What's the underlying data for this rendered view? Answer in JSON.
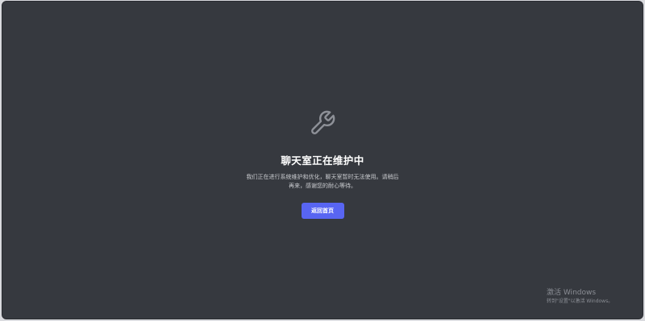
{
  "maintenance": {
    "icon": "wrench-icon",
    "title": "聊天室正在维护中",
    "description": "我们正在进行系统维护和优化，聊天室暂时无法使用。请稍后再来，感谢您的耐心等待。",
    "button_label": "返回首页"
  },
  "activation": {
    "title": "激活 Windows",
    "subtitle": "转到\"设置\"以激活 Windows。"
  },
  "colors": {
    "background": "#36393f",
    "accent": "#5865f2",
    "title": "#ffffff",
    "text": "#c9cbcf"
  }
}
